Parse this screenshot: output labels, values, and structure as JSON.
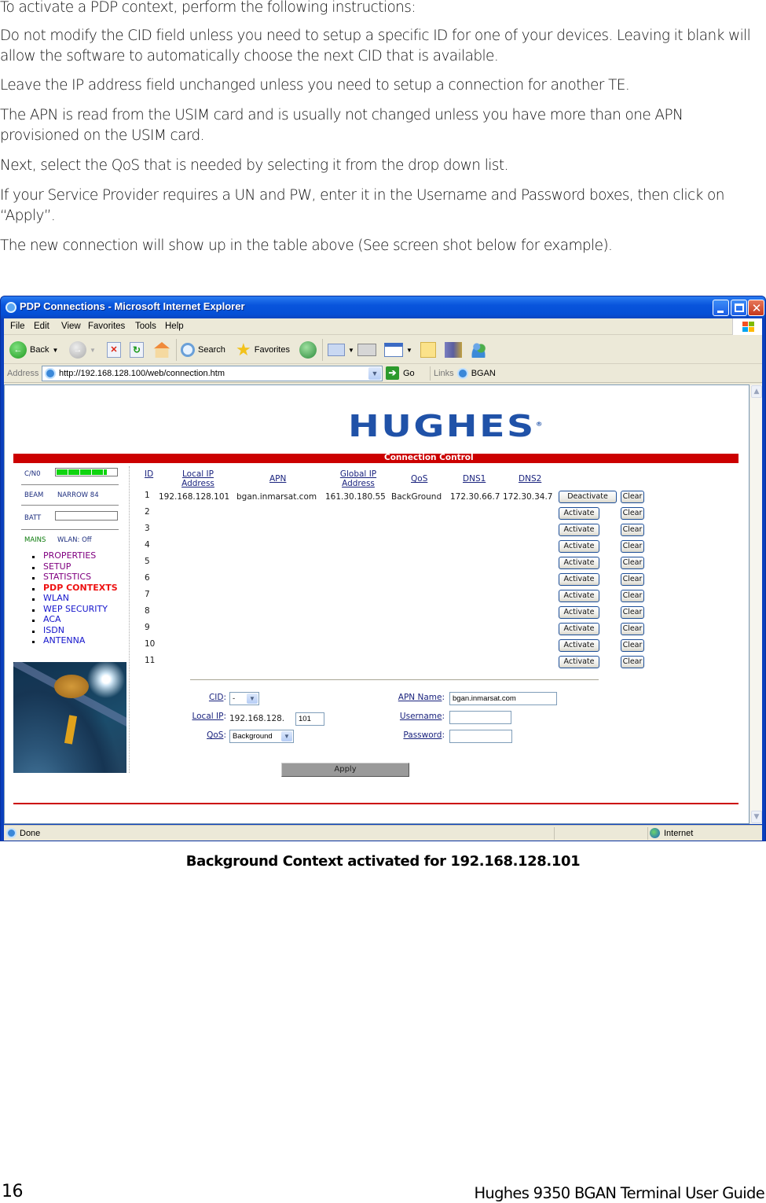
{
  "document": {
    "paragraphs": [
      "To activate a PDP context, perform the following instructions:",
      "Do not modify the CID field unless you need to setup a specific ID for one of your devices. Leaving it blank will allow the software to automatically choose the next CID that is available.",
      "Leave the IP address field unchanged unless you need to setup a connection for another TE.",
      "The APN is read from the USIM card and is usually not changed unless you have more than one APN provisioned on the USIM card.",
      "Next, select the QoS that is needed by selecting it from the drop down list.",
      "If your Service Provider requires a UN and PW, enter it in the Username and Password boxes, then click on “Apply”.",
      "The new connection will show up in the table above (See screen shot below for example)."
    ],
    "caption": "Background Context activated for 192.168.128.101",
    "footer": {
      "page_number": "16",
      "guide_title": "Hughes 9350 BGAN Terminal User Guide"
    }
  },
  "browser": {
    "title": "PDP Connections - Microsoft Internet Explorer",
    "menu": [
      "File",
      "Edit",
      "View",
      "Favorites",
      "Tools",
      "Help"
    ],
    "toolbar": {
      "back": "Back",
      "search": "Search",
      "favorites": "Favorites"
    },
    "address_label": "Address",
    "url": "http://192.168.128.100/web/connection.htm",
    "go_label": "Go",
    "links_label": "Links",
    "link_bgan": "BGAN",
    "status_text": "Done",
    "zone_text": "Internet"
  },
  "page": {
    "logo": "HUGHES",
    "section_title": "Connection Control",
    "sidebar": {
      "cn0_label": "C/N0",
      "cn0_level_fraction": 0.85,
      "beam_label": "BEAM",
      "beam_value": "NARROW 84",
      "batt_label": "BATT",
      "mains_label": "MAINS",
      "wlan_status": "WLAN: Off",
      "nav": [
        {
          "label": "PROPERTIES",
          "state": "visited"
        },
        {
          "label": "SETUP",
          "state": "visited"
        },
        {
          "label": "STATISTICS",
          "state": "visited"
        },
        {
          "label": "PDP CONTEXTS",
          "state": "active"
        },
        {
          "label": "WLAN",
          "state": "link"
        },
        {
          "label": "WEP SECURITY",
          "state": "link"
        },
        {
          "label": "ACA",
          "state": "link"
        },
        {
          "label": "ISDN",
          "state": "link"
        },
        {
          "label": "ANTENNA",
          "state": "link"
        }
      ]
    },
    "table": {
      "headers": {
        "id": "ID",
        "local_ip_1": "Local IP",
        "local_ip_2": "Address",
        "apn": "APN",
        "global_ip_1": "Global IP",
        "global_ip_2": "Address",
        "qos": "QoS",
        "dns1": "DNS1",
        "dns2": "DNS2"
      },
      "rows": [
        {
          "id": "1",
          "local_ip": "192.168.128.101",
          "apn": "bgan.inmarsat.com",
          "global_ip": "161.30.180.55",
          "qos": "BackGround",
          "dns1": "172.30.66.7",
          "dns2": "172.30.34.7",
          "action": "Deactivate",
          "clear": "Clear"
        },
        {
          "id": "2",
          "action": "Activate",
          "clear": "Clear"
        },
        {
          "id": "3",
          "action": "Activate",
          "clear": "Clear"
        },
        {
          "id": "4",
          "action": "Activate",
          "clear": "Clear"
        },
        {
          "id": "5",
          "action": "Activate",
          "clear": "Clear"
        },
        {
          "id": "6",
          "action": "Activate",
          "clear": "Clear"
        },
        {
          "id": "7",
          "action": "Activate",
          "clear": "Clear"
        },
        {
          "id": "8",
          "action": "Activate",
          "clear": "Clear"
        },
        {
          "id": "9",
          "action": "Activate",
          "clear": "Clear"
        },
        {
          "id": "10",
          "action": "Activate",
          "clear": "Clear"
        },
        {
          "id": "11",
          "action": "Activate",
          "clear": "Clear"
        }
      ]
    },
    "form": {
      "cid_label": "CID",
      "cid_value": "-",
      "local_ip_label": "Local IP",
      "local_ip_prefix": "192.168.128.",
      "local_ip_suffix": "101",
      "qos_label": "QoS",
      "qos_value": "Background",
      "apn_label": "APN Name",
      "apn_value": "bgan.inmarsat.com",
      "username_label": "Username",
      "username_value": "",
      "password_label": "Password",
      "password_value": "",
      "apply_label": "Apply"
    }
  }
}
